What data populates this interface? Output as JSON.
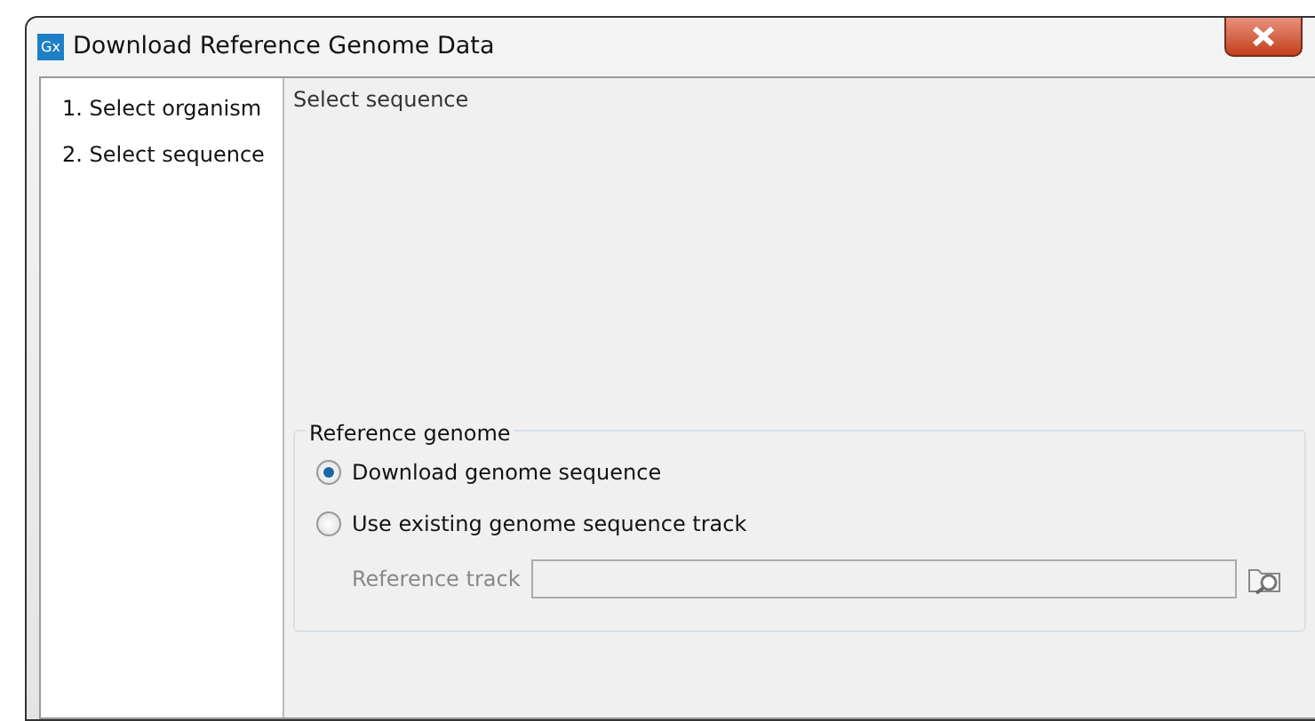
{
  "window": {
    "app_icon": "Gx",
    "title": "Download Reference Genome Data"
  },
  "steps": [
    {
      "label": "1. Select organism"
    },
    {
      "label": "2. Select sequence"
    }
  ],
  "panel": {
    "title": "Select sequence"
  },
  "group": {
    "title": "Reference genome",
    "options": [
      {
        "label": "Download genome sequence",
        "selected": true
      },
      {
        "label": "Use existing genome sequence track",
        "selected": false
      }
    ],
    "field": {
      "label": "Reference track",
      "disabled": true
    }
  }
}
